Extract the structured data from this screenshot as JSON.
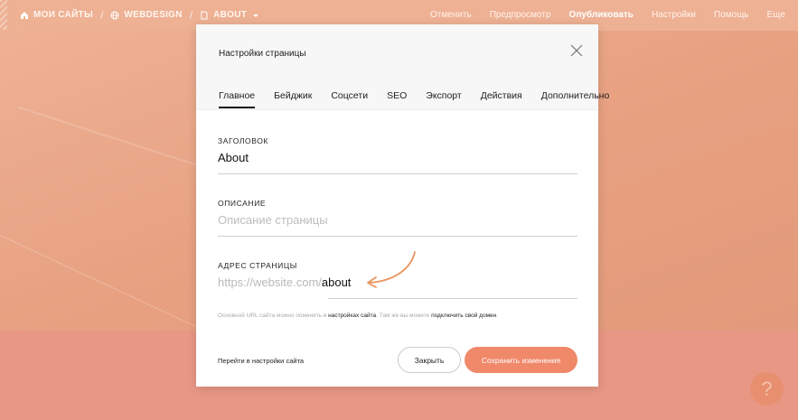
{
  "topbar": {
    "crumbs": [
      "МОИ САЙТЫ",
      "WEBDESIGN",
      "ABOUT"
    ],
    "menu": [
      "Отменить",
      "Предпросмотр",
      "Опубликовать",
      "Настройки",
      "Помощь",
      "Еще"
    ]
  },
  "modal": {
    "title": "Настройки страницы",
    "tabs": [
      "Главное",
      "Бейджик",
      "Соцсети",
      "SEO",
      "Экспорт",
      "Действия",
      "Дополнительно"
    ],
    "fields": {
      "title_label": "ЗАГОЛОВОК",
      "title_value": "About",
      "description_label": "ОПИСАНИЕ",
      "description_placeholder": "Описание страницы",
      "address_label": "АДРЕС СТРАНИЦЫ",
      "address_prefix": "https://website.com/",
      "address_slug": "about"
    },
    "hint": {
      "part1": "Основной URL сайта можно поменять в ",
      "link1": "настройках сайта",
      "part2": ". Там же вы можете ",
      "link2": "подключить свой домен",
      "part3": "."
    },
    "footer": {
      "settings_link": "Перейти в настройки сайта",
      "close_label": "Закрыть",
      "save_label": "Сохранить изменения"
    }
  },
  "help": {
    "label": "?"
  },
  "colors": {
    "accent": "#f0886a",
    "topbar": "#eeb194"
  }
}
